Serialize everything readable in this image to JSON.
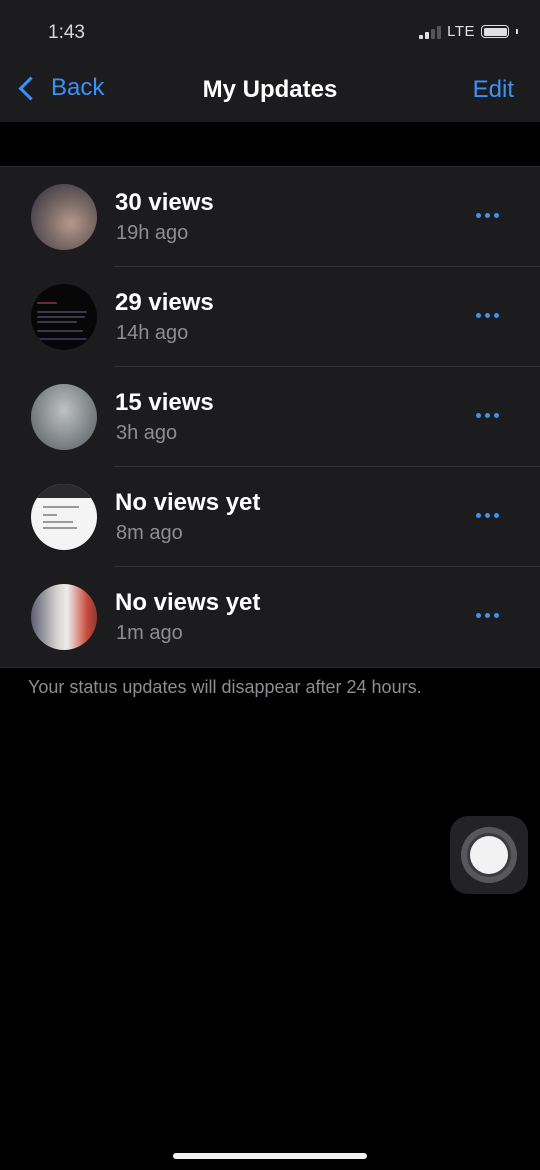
{
  "status_bar": {
    "time": "1:43",
    "network": "LTE",
    "signal_bars": 2,
    "battery_level": 1.0
  },
  "nav": {
    "back_label": "Back",
    "title": "My Updates",
    "edit_label": "Edit"
  },
  "updates": [
    {
      "views": "30 views",
      "time": "19h ago",
      "more_icon": "more-horizontal-icon"
    },
    {
      "views": "29 views",
      "time": "14h ago",
      "more_icon": "more-horizontal-icon"
    },
    {
      "views": "15 views",
      "time": "3h ago",
      "more_icon": "more-horizontal-icon"
    },
    {
      "views": "No views yet",
      "time": "8m ago",
      "more_icon": "more-horizontal-icon"
    },
    {
      "views": "No views yet",
      "time": "1m ago",
      "more_icon": "more-horizontal-icon"
    }
  ],
  "footer_note": "Your status updates will disappear after 24 hours.",
  "colors": {
    "accent": "#3b91f6",
    "background": "#000000",
    "surface": "#1c1c1e",
    "secondary_text": "#8d8d92"
  }
}
